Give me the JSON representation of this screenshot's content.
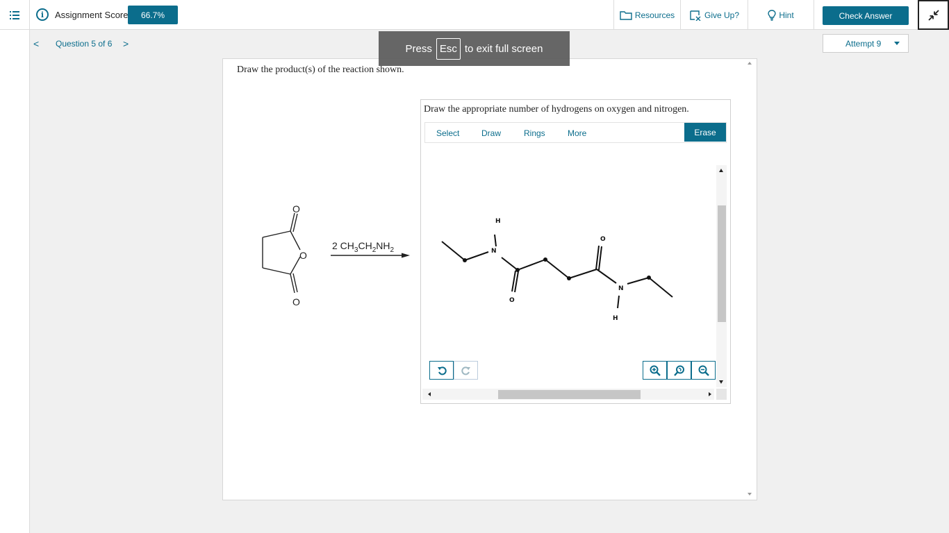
{
  "header": {
    "score_label": "Assignment Score:",
    "score_value": "66.7%",
    "resources_label": "Resources",
    "give_up_label": "Give Up?",
    "hint_label": "Hint",
    "check_answer_label": "Check Answer"
  },
  "nav": {
    "question_label": "Question 5 of 6",
    "prev_symbol": "<",
    "next_symbol": ">",
    "attempt_label": "Attempt 9"
  },
  "fullscreen_toast": {
    "press": "Press",
    "key": "Esc",
    "rest": "to exit full screen"
  },
  "question": {
    "prompt": "Draw the product(s) of the reaction shown.",
    "reagent_coef": "2 CH",
    "reagent_sub1": "3",
    "reagent_mid": "CH",
    "reagent_sub2": "2",
    "reagent_end": "NH",
    "reagent_sub3": "2",
    "reactant_atoms": {
      "o_top": "O",
      "o_ring": "O",
      "o_bottom": "O"
    }
  },
  "editor": {
    "instructions": "Draw the appropriate number of hydrogens on oxygen and nitrogen.",
    "tools": {
      "select": "Select",
      "draw": "Draw",
      "rings": "Rings",
      "more": "More"
    },
    "erase_label": "Erase",
    "product_atoms": {
      "h1": "H",
      "n1": "N",
      "o1": "O",
      "o2": "O",
      "n2": "N",
      "h2": "H"
    }
  },
  "icons": {
    "menu": "list-icon",
    "info": "info-icon",
    "resources": "folder-icon",
    "give_up": "give-up-icon",
    "hint": "lightbulb-icon",
    "exit_fullscreen": "collapse-icon",
    "undo": "undo-icon",
    "redo": "redo-icon",
    "zoom_in": "zoom-in-icon",
    "zoom_reset": "zoom-reset-icon",
    "zoom_out": "zoom-out-icon"
  },
  "colors": {
    "accent": "#0b6d8c"
  }
}
